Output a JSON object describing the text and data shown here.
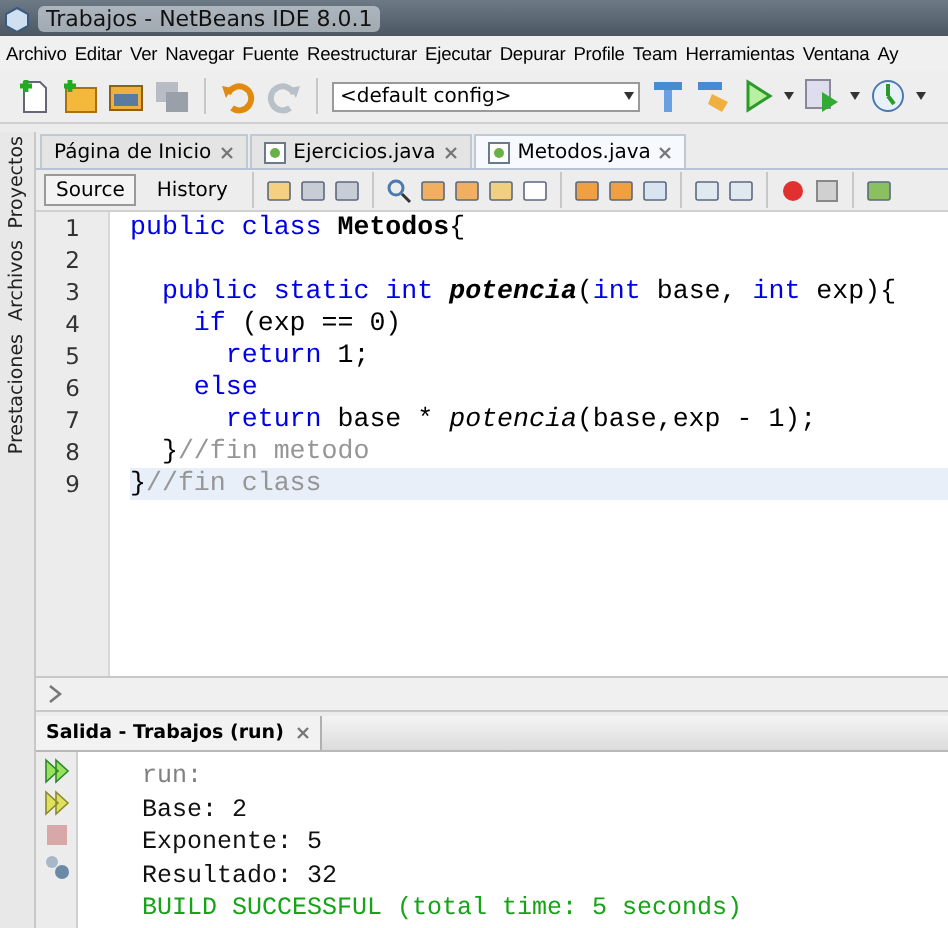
{
  "window": {
    "title": "Trabajos - NetBeans IDE 8.0.1"
  },
  "menu": [
    "Archivo",
    "Editar",
    "Ver",
    "Navegar",
    "Fuente",
    "Reestructurar",
    "Ejecutar",
    "Depurar",
    "Profile",
    "Team",
    "Herramientas",
    "Ventana",
    "Ay"
  ],
  "toolbar": {
    "config": "<default config>"
  },
  "side_tabs": [
    "Proyectos",
    "Archivos",
    "Prestaciones"
  ],
  "editor_tabs": [
    {
      "label": "Página de Inicio",
      "selected": false
    },
    {
      "label": "Ejercicios.java",
      "selected": false
    },
    {
      "label": "Metodos.java",
      "selected": true
    }
  ],
  "view_tabs": [
    {
      "label": "Source",
      "selected": true
    },
    {
      "label": "History",
      "selected": false
    }
  ],
  "code": [
    {
      "number": "1",
      "current": false,
      "tokens": [
        {
          "kind": "keyword",
          "text": "public class "
        },
        {
          "kind": "bold",
          "text": "Metodos"
        },
        {
          "kind": "plain",
          "text": "{"
        }
      ]
    },
    {
      "number": "2"
    },
    {
      "number": "3",
      "current": false,
      "tokens": [
        {
          "kind": "keyword",
          "text": "  public static int "
        },
        {
          "kind": "bolditalic",
          "text": "potencia"
        },
        {
          "kind": "plain",
          "text": "("
        },
        {
          "kind": "keyword",
          "text": "int"
        },
        {
          "kind": "plain",
          "text": " base, "
        },
        {
          "kind": "keyword",
          "text": "int"
        },
        {
          "kind": "plain",
          "text": " exp){"
        }
      ]
    },
    {
      "number": "4",
      "current": false,
      "tokens": [
        {
          "kind": "keyword",
          "text": "    if"
        },
        {
          "kind": "plain",
          "text": " (exp == 0)"
        }
      ]
    },
    {
      "number": "5",
      "current": false,
      "tokens": [
        {
          "kind": "keyword",
          "text": "      return"
        },
        {
          "kind": "plain",
          "text": " 1;"
        }
      ]
    },
    {
      "number": "6",
      "current": false,
      "tokens": [
        {
          "kind": "keyword",
          "text": "    else"
        }
      ]
    },
    {
      "number": "7",
      "current": false,
      "tokens": [
        {
          "kind": "keyword",
          "text": "      return"
        },
        {
          "kind": "plain",
          "text": " base * "
        },
        {
          "kind": "italic",
          "text": "potencia"
        },
        {
          "kind": "plain",
          "text": "(base,exp - 1);"
        }
      ]
    },
    {
      "number": "8",
      "current": false,
      "tokens": [
        {
          "kind": "plain",
          "text": "  }"
        },
        {
          "kind": "comment",
          "text": "//fin metodo"
        }
      ]
    },
    {
      "number": "9",
      "current": true,
      "tokens": [
        {
          "kind": "plain",
          "text": "}"
        },
        {
          "kind": "comment",
          "text": "//fin class"
        }
      ]
    }
  ],
  "output": {
    "title": "Salida - Trabajos (run)",
    "lines": [
      {
        "kind": "meta",
        "text": "run:"
      },
      {
        "kind": "plain",
        "text": "Base: 2"
      },
      {
        "kind": "plain",
        "text": "Exponente: 5"
      },
      {
        "kind": "plain",
        "text": "Resultado: 32"
      },
      {
        "kind": "success",
        "text": "BUILD SUCCESSFUL (total time: 5 seconds)"
      }
    ]
  }
}
